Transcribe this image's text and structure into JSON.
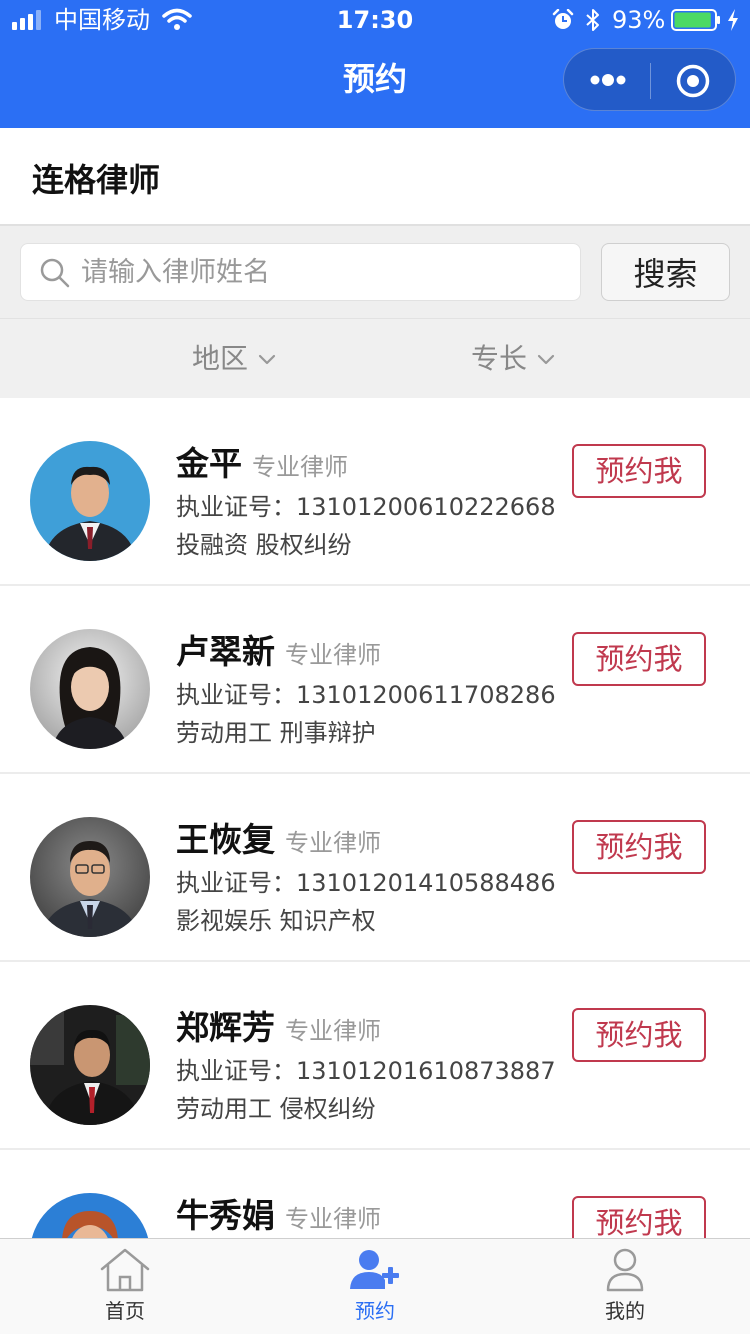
{
  "status_bar": {
    "carrier": "中国移动",
    "time": "17:30",
    "battery": "93%",
    "battery_level": 0.93
  },
  "nav": {
    "title": "预约"
  },
  "firm": {
    "name": "连格律师"
  },
  "search": {
    "placeholder": "请输入律师姓名",
    "button_label": "搜索"
  },
  "filters": {
    "region_label": "地区",
    "skill_label": "专长"
  },
  "lawyers": [
    {
      "name": "金平",
      "title": "专业律师",
      "license_label": "执业证号：",
      "license": "13101200610222668",
      "fields": "投融资 股权纠纷",
      "book_label": "预约我"
    },
    {
      "name": "卢翠新",
      "title": "专业律师",
      "license_label": "执业证号：",
      "license": "13101200611708286",
      "fields": "劳动用工 刑事辩护",
      "book_label": "预约我"
    },
    {
      "name": "王恢复",
      "title": "专业律师",
      "license_label": "执业证号：",
      "license": "13101201410588486",
      "fields": "影视娱乐 知识产权",
      "book_label": "预约我"
    },
    {
      "name": "郑辉芳",
      "title": "专业律师",
      "license_label": "执业证号：",
      "license": "13101201610873887",
      "fields": "劳动用工 侵权纠纷",
      "book_label": "预约我"
    },
    {
      "name": "牛秀娟",
      "title": "专业律师",
      "book_label": "预约我"
    }
  ],
  "tabbar": {
    "home": "首页",
    "booking": "预约",
    "mine": "我的"
  },
  "colors": {
    "brand_blue": "#2b6ff4",
    "book_red": "#c0394e"
  }
}
